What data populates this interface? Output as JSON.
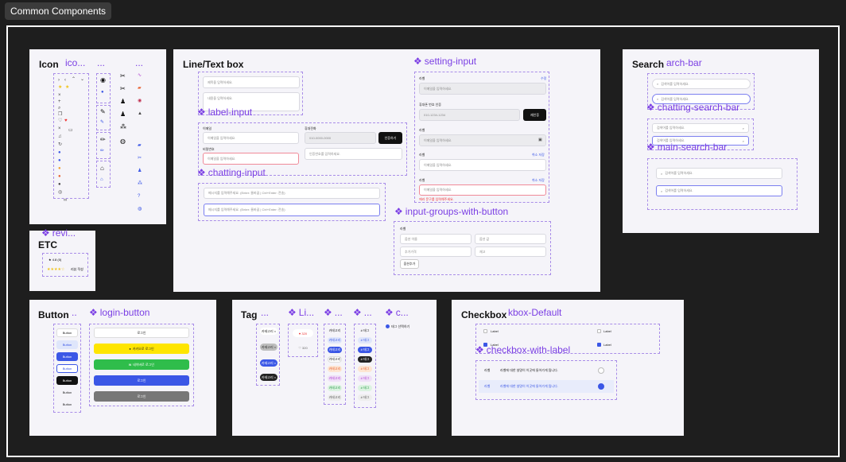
{
  "page": {
    "title": "Common Components"
  },
  "frames": {
    "icon": {
      "title": "Icon",
      "variants": [
        "ico...",
        "...",
        "..."
      ]
    },
    "etc": {
      "title": "ETC",
      "variant": "revi...",
      "rating_small": "★ 4.8 (0)",
      "rating_text": "리뷰 작성"
    },
    "line_text": {
      "title": "Line/Text box",
      "label_input": {
        "variant": "label-input",
        "placeholder1": "제목을 입력하세요.",
        "placeholder2": "내용을 입력하세요."
      },
      "chatting_input": {
        "variant": "chatting-input",
        "name_label": "이메일",
        "name_placeholder": "이메일을 입력하세요.",
        "phone_label": "휴대전화",
        "phone_placeholder": "010-0000-0000",
        "verify_button": "인증하기",
        "password_label": "비밀번호",
        "password_placeholder": "이메일을 입력하세요.",
        "code_placeholder": "인증번호를 입력하세요."
      },
      "chat_field": {
        "placeholder1": "메시지를 입력해주세요. (Enter: 줄바꿈 | Ctrl+Enter: 전송)",
        "placeholder2": "메시지를 입력해주세요. (Enter: 줄바꿈 | Ctrl+Enter: 전송)"
      },
      "setting_input": {
        "variant": "setting-input",
        "label": "라벨",
        "edit": "수정",
        "placeholder": "이메일을 입력하세요.",
        "phone_label": "휴대폰 번호 인증",
        "phone_value": "010-1234-1234",
        "change_button": "재인증",
        "error": "에러 문구를 입력해주세요.",
        "actions": "취소  저장"
      },
      "input_groups": {
        "variant": "input-groups-with-button",
        "label": "라벨",
        "cells": [
          "옵션 이름",
          "옵션 값",
          "추가가격",
          "재고"
        ],
        "add_button": "옵션추가"
      }
    },
    "search": {
      "title": "Search",
      "variant": "arch-bar",
      "chatting_variant": "chatting-search-bar",
      "main_variant": "main-search-bar",
      "placeholder": "검색어를 입력하세요."
    },
    "button": {
      "title": "Button",
      "variant": "..",
      "login_variant": "login-button",
      "left_buttons": [
        "Button",
        "Button",
        "Button",
        "Button",
        "Button",
        "Button",
        "Button"
      ],
      "login_buttons": [
        "로그인",
        "카카오로 로그인",
        "네이버로 로그인",
        "로그인",
        "로그인"
      ]
    },
    "tag": {
      "title": "Tag",
      "variants": [
        "...",
        "Li...",
        "...",
        "...",
        "c..."
      ],
      "col1": [
        "카테고리 ×",
        "카테고리 ×",
        "카테고리 ×",
        "카테고리 ×"
      ],
      "like": [
        "♥ 320",
        "♡ 320"
      ],
      "col3": [
        "카테고리",
        "카테고리",
        "카테고리",
        "카테고리",
        "카테고리",
        "카테고리",
        "카테고리",
        "카테고리"
      ],
      "col4": [
        "# 태그",
        "# 태그",
        "# 태그",
        "# 태그",
        "# 태그",
        "# 태그",
        "# 태그",
        "# 태그"
      ],
      "check_tag": "태그 선택하기"
    },
    "checkbox": {
      "title": "Checkbox",
      "variant": "kbox-Default",
      "label_variant": "checkbox-with-label",
      "labels": [
        "Label",
        "Label",
        "Label",
        "Label"
      ],
      "row_title": "라벨",
      "row_desc": "라벨에 대한 설명이 이곳에 들어가게 됩니다."
    }
  },
  "colors": {
    "accent": "#7b3fe4",
    "primary": "#3b57e6",
    "kakao": "#fee500",
    "naver": "#03c75a"
  }
}
